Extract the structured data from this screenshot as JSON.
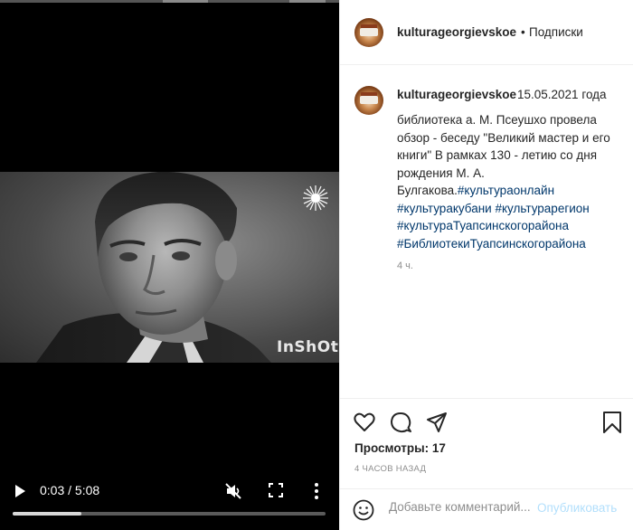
{
  "header": {
    "username": "kulturageorgievskoe",
    "separator": "•",
    "follow_label": "Подписки",
    "avatar_icon": "avatar-photo"
  },
  "caption": {
    "username": "kulturageorgievskoe",
    "date": "15.05.2021 года",
    "text": "библиотека а. М. Псеушхо провела обзор - беседу \"Великий мастер и его книги\" В рамках 130 - летию со дня рождения М. А. Булгакова.",
    "hashtags": [
      "#культураонлайн",
      "#культуракубани",
      "#культурарегион",
      "#культураТуапсинскогорайона",
      "#БиблиотекиТуапсинскогорайона"
    ],
    "age": "4 ч."
  },
  "video": {
    "time": "0:03 / 5:08",
    "progress": 0.22,
    "watermark": "InShOt",
    "icons": [
      "play-icon",
      "mute-icon",
      "fullscreen-icon",
      "more-icon"
    ]
  },
  "actions": {
    "icons": [
      "heart-icon",
      "comment-icon",
      "share-icon",
      "bookmark-icon"
    ],
    "views_label": "Просмотры:",
    "views_count": "17",
    "posted": "4 ЧАСОВ НАЗАД"
  },
  "comment": {
    "placeholder": "Добавьте комментарий...",
    "publish_label": "Опубликовать"
  },
  "colors": {
    "link": "#00376b",
    "publish_disabled": "#b2dffc",
    "muted": "#8e8e8e"
  }
}
